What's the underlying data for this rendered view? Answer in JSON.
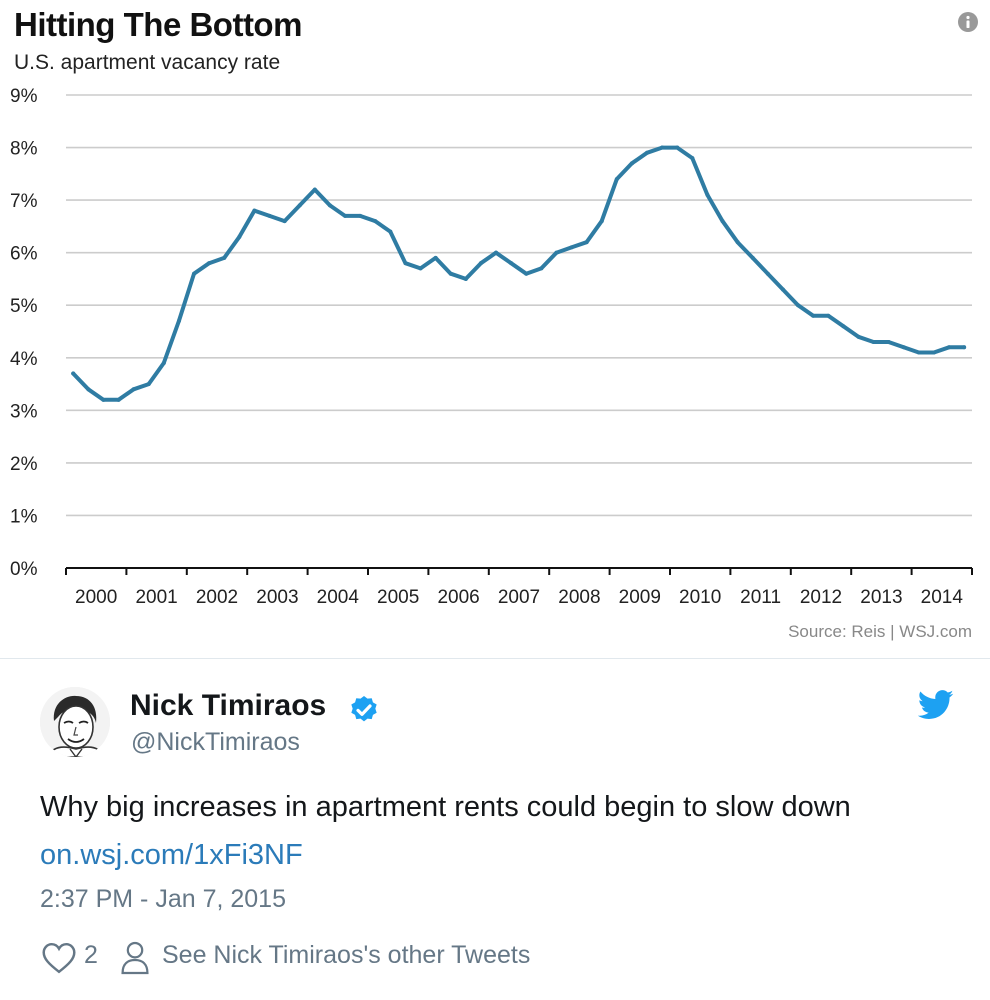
{
  "colors": {
    "line": "#2f7ca3",
    "grid": "#cccccc",
    "axis": "#111111",
    "twitter_blue": "#1da1f2",
    "link": "#2b7bb9",
    "muted": "#657786"
  },
  "chart_data": {
    "type": "line",
    "title": "Hitting The Bottom",
    "subtitle": "U.S. apartment vacancy rate",
    "source": "Source: Reis  |  WSJ.com",
    "ylim": [
      0,
      9
    ],
    "yticks": [
      0,
      1,
      2,
      3,
      4,
      5,
      6,
      7,
      8,
      9
    ],
    "ytick_labels": [
      "0%",
      "1%",
      "2%",
      "3%",
      "4%",
      "5%",
      "6%",
      "7%",
      "8%",
      "9%"
    ],
    "xlim": [
      2000,
      2015
    ],
    "xtick_labels": [
      "2000",
      "2001",
      "2002",
      "2003",
      "2004",
      "2005",
      "2006",
      "2007",
      "2008",
      "2009",
      "2010",
      "2011",
      "2012",
      "2013",
      "2014"
    ],
    "grid": true,
    "series": [
      {
        "x": [
          2000.12,
          2000.37,
          2000.62,
          2000.87,
          2001.12,
          2001.37,
          2001.62,
          2001.87,
          2002.12,
          2002.37,
          2002.62,
          2002.87,
          2003.12,
          2003.37,
          2003.62,
          2003.87,
          2004.12,
          2004.37,
          2004.62,
          2004.87,
          2005.12,
          2005.37,
          2005.62,
          2005.87,
          2006.12,
          2006.37,
          2006.62,
          2006.87,
          2007.12,
          2007.37,
          2007.62,
          2007.87,
          2008.12,
          2008.37,
          2008.62,
          2008.87,
          2009.12,
          2009.37,
          2009.62,
          2009.87,
          2010.12,
          2010.37,
          2010.62,
          2010.87,
          2011.12,
          2011.37,
          2011.62,
          2011.87,
          2012.12,
          2012.37,
          2012.62,
          2012.87,
          2013.12,
          2013.37,
          2013.62,
          2013.87,
          2014.12,
          2014.37,
          2014.62,
          2014.87
        ],
        "values": [
          3.7,
          3.4,
          3.2,
          3.2,
          3.4,
          3.5,
          3.9,
          4.7,
          5.6,
          5.8,
          5.9,
          6.3,
          6.8,
          6.7,
          6.6,
          6.9,
          7.2,
          6.9,
          6.7,
          6.7,
          6.6,
          6.4,
          5.8,
          5.7,
          5.9,
          5.6,
          5.5,
          5.8,
          6.0,
          5.8,
          5.6,
          5.7,
          6.0,
          6.1,
          6.2,
          6.6,
          7.4,
          7.7,
          7.9,
          8.0,
          8.0,
          7.8,
          7.1,
          6.6,
          6.2,
          5.9,
          5.6,
          5.3,
          5.0,
          4.8,
          4.8,
          4.6,
          4.4,
          4.3,
          4.3,
          4.2,
          4.1,
          4.1,
          4.2,
          4.2
        ]
      }
    ]
  },
  "tweet": {
    "author_name": "Nick Timiraos",
    "handle": "@NickTimiraos",
    "text": "Why big increases in apartment rents could begin to slow down",
    "link": "on.wsj.com/1xFi3NF",
    "timestamp": "2:37 PM - Jan 7, 2015",
    "like_count": "2",
    "other_tweets_label": "See Nick Timiraos's other Tweets"
  }
}
